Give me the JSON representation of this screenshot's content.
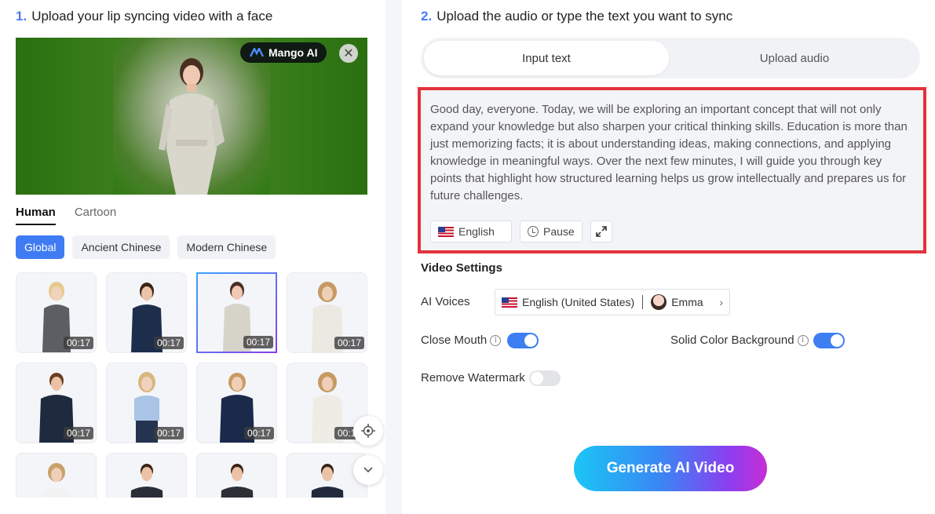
{
  "left": {
    "step_number": "1.",
    "step_title": "Upload your lip syncing video with a face",
    "brand_label": "Mango AI",
    "category_tabs": [
      "Human",
      "Cartoon"
    ],
    "filters": [
      "Global",
      "Ancient Chinese",
      "Modern Chinese"
    ],
    "avatar_durations": [
      "00:17",
      "00:17",
      "00:17",
      "00:17",
      "00:17",
      "00:17",
      "00:17",
      "00:17"
    ]
  },
  "right": {
    "step_number": "2.",
    "step_title": "Upload the audio or type the text you want to sync",
    "mode_tabs": [
      "Input text",
      "Upload audio"
    ],
    "text_content": "Good day, everyone. Today, we will be exploring an important concept that will not only expand your knowledge but also sharpen your critical thinking skills. Education is more than just memorizing facts; it is about understanding ideas, making connections, and applying knowledge in meaningful ways. Over the next few minutes, I will guide you through key points that highlight how structured learning helps us grow intellectually and prepares us for future challenges.",
    "language_label": "English",
    "pause_label": "Pause",
    "settings_title": "Video Settings",
    "ai_voices_label": "AI Voices",
    "voice_language": "English (United States)",
    "voice_name": "Emma",
    "close_mouth_label": "Close Mouth",
    "close_mouth_on": true,
    "solid_bg_label": "Solid Color Background",
    "solid_bg_on": true,
    "remove_watermark_label": "Remove Watermark",
    "remove_watermark_on": false,
    "generate_label": "Generate AI Video"
  },
  "colors": {
    "accent": "#3d7ef3",
    "highlight_border": "#e3323b",
    "preview_green": "#2f7a12"
  }
}
